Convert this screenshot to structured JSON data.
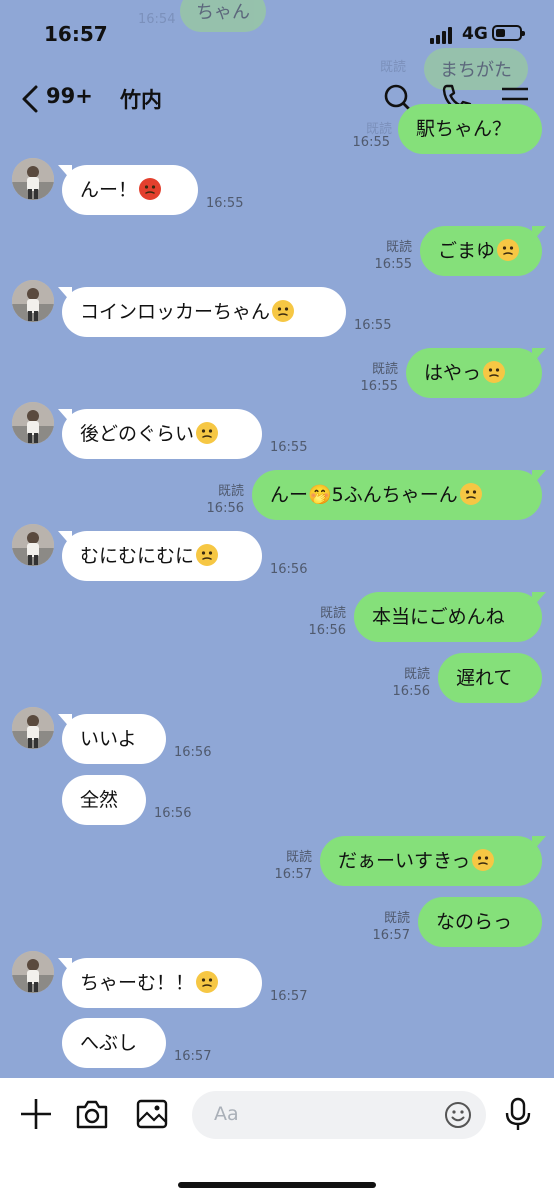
{
  "status": {
    "time": "16:57",
    "network": "4G"
  },
  "header": {
    "badge": "99+",
    "title": "竹内"
  },
  "ghost": {
    "t1": "16:54",
    "t2": "既読",
    "t3": "16:55",
    "t4": "既読",
    "b1": "ちゃん",
    "b2": "まちがた",
    "b3": "駅ちゃん？"
  },
  "messages": [
    {
      "side": "in",
      "text": "んー！",
      "time": "16:55",
      "emoji": "angry-face"
    },
    {
      "side": "out",
      "text": "ごまゆ",
      "read": "既読",
      "time": "16:55",
      "emoji": "crying-face"
    },
    {
      "side": "in",
      "text": "コインロッカーちゃん",
      "time": "16:55",
      "emoji": "steam-face"
    },
    {
      "side": "out",
      "text": "はやっ",
      "read": "既読",
      "time": "16:55",
      "emoji": "flushed-face"
    },
    {
      "side": "in",
      "text": "後どのぐらい",
      "time": "16:55",
      "emoji": "flushed-face"
    },
    {
      "side": "out",
      "text": "んー🤭5ふんちゃーん",
      "read": "既読",
      "time": "16:56",
      "emoji": "hugging-face"
    },
    {
      "side": "in",
      "text": "むにむにむに",
      "time": "16:56",
      "emoji": "steam-face"
    },
    {
      "side": "out",
      "text": "本当にごめんね",
      "read": "既読",
      "time": "16:56"
    },
    {
      "side": "out",
      "text": "遅れて",
      "read": "既読",
      "time": "16:56"
    },
    {
      "side": "in",
      "text": "いいよ",
      "time": "16:56"
    },
    {
      "side": "in",
      "text": "全然",
      "time": "16:56"
    },
    {
      "side": "out",
      "text": "だぁーいすきっ",
      "read": "既読",
      "time": "16:57",
      "emoji": "steam-face"
    },
    {
      "side": "out",
      "text": "なのらっ",
      "read": "既読",
      "time": "16:57"
    },
    {
      "side": "in",
      "text": "ちゃーむ！！",
      "time": "16:57",
      "emoji": "steam-face"
    },
    {
      "side": "in",
      "text": "へぶし",
      "time": "16:57"
    }
  ],
  "input": {
    "placeholder": "Aa"
  },
  "colors": {
    "background": "#8fa7d6",
    "outgoing": "#85e07a",
    "incoming": "#ffffff"
  }
}
